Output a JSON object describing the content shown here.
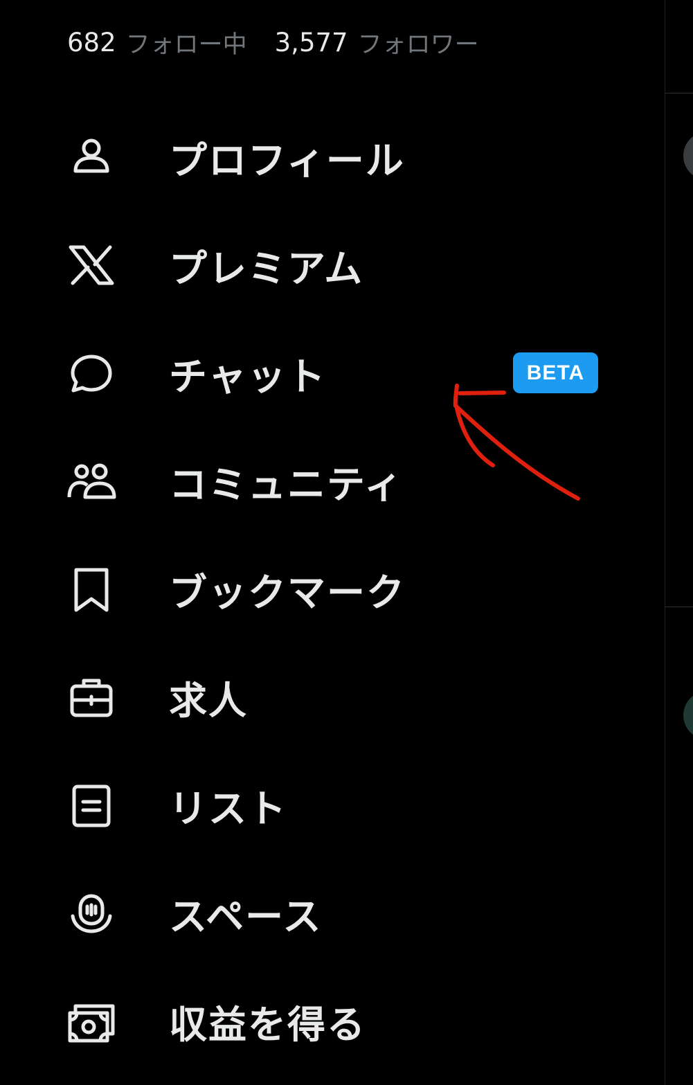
{
  "stats": {
    "following_count": "682",
    "following_label": "フォロー中",
    "followers_count": "3,577",
    "followers_label": "フォロワー"
  },
  "menu": [
    {
      "label": "プロフィール",
      "icon": "person-icon"
    },
    {
      "label": "プレミアム",
      "icon": "x-logo-icon"
    },
    {
      "label": "チャット",
      "icon": "chat-bubble-icon",
      "badge": "BETA"
    },
    {
      "label": "コミュニティ",
      "icon": "communities-icon"
    },
    {
      "label": "ブックマーク",
      "icon": "bookmark-icon"
    },
    {
      "label": "求人",
      "icon": "briefcase-icon"
    },
    {
      "label": "リスト",
      "icon": "list-icon"
    },
    {
      "label": "スペース",
      "icon": "spaces-microphone-icon"
    },
    {
      "label": "収益を得る",
      "icon": "money-icon"
    }
  ],
  "colors": {
    "background": "#000000",
    "text": "#e7e9ea",
    "secondary_text": "#71767b",
    "badge_bg": "#1d9bf0",
    "annotation": "#e0200f"
  }
}
